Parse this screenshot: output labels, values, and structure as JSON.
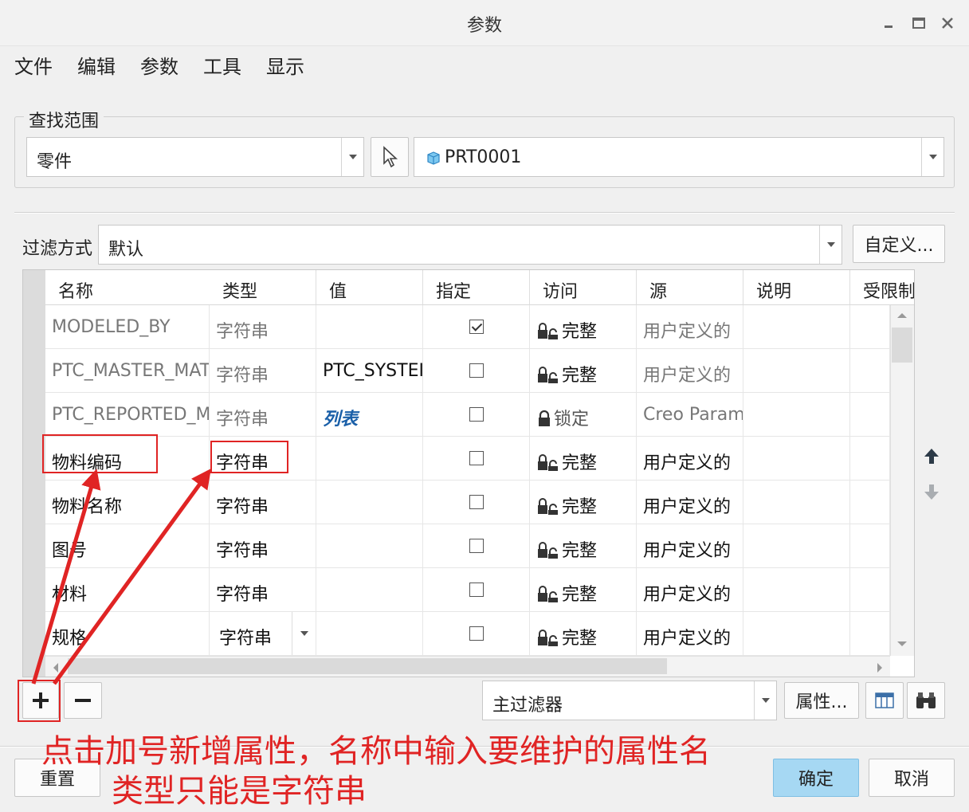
{
  "window": {
    "title": "参数"
  },
  "menu": [
    "文件",
    "编辑",
    "参数",
    "工具",
    "显示"
  ],
  "scope": {
    "legend": "查找范围",
    "type_value": "零件",
    "model_value": "PRT0001"
  },
  "filter": {
    "label": "过滤方式",
    "value": "默认",
    "customize_label": "自定义..."
  },
  "table": {
    "headers": [
      "名称",
      "类型",
      "值",
      "指定",
      "访问",
      "源",
      "说明",
      "受限制"
    ],
    "rows": [
      {
        "name": "MODELED_BY",
        "type": "字符串",
        "value": "",
        "designated": true,
        "access": "完整",
        "source": "用户定义的",
        "style": "gray"
      },
      {
        "name": "PTC_MASTER_MAT",
        "type": "字符串",
        "value": "PTC_SYSTEI",
        "designated": false,
        "access": "完整",
        "source": "用户定义的",
        "style": "gray"
      },
      {
        "name": "PTC_REPORTED_M",
        "type": "字符串",
        "value": "列表",
        "designated": false,
        "access": "锁定",
        "source": "Creo Param",
        "style": "gray"
      },
      {
        "name": "物料编码",
        "type": "字符串",
        "value": "",
        "designated": false,
        "access": "完整",
        "source": "用户定义的",
        "style": "dark"
      },
      {
        "name": "物料名称",
        "type": "字符串",
        "value": "",
        "designated": false,
        "access": "完整",
        "source": "用户定义的",
        "style": "dark"
      },
      {
        "name": "图号",
        "type": "字符串",
        "value": "",
        "designated": false,
        "access": "完整",
        "source": "用户定义的",
        "style": "dark"
      },
      {
        "name": "材料",
        "type": "字符串",
        "value": "",
        "designated": false,
        "access": "完整",
        "source": "用户定义的",
        "style": "dark"
      },
      {
        "name": "规格",
        "type": "字符串",
        "value": "",
        "designated": false,
        "access": "完整",
        "source": "用户定义的",
        "style": "dark"
      }
    ]
  },
  "bottom": {
    "main_filter": "主过滤器",
    "properties_label": "属性..."
  },
  "footer": {
    "reset_label": "重置",
    "ok_label": "确定",
    "cancel_label": "取消"
  },
  "annotation": {
    "line1": "点击加号新增属性，名称中输入要维护的属性名",
    "line2": "类型只能是字符串",
    "color": "#e02424"
  }
}
